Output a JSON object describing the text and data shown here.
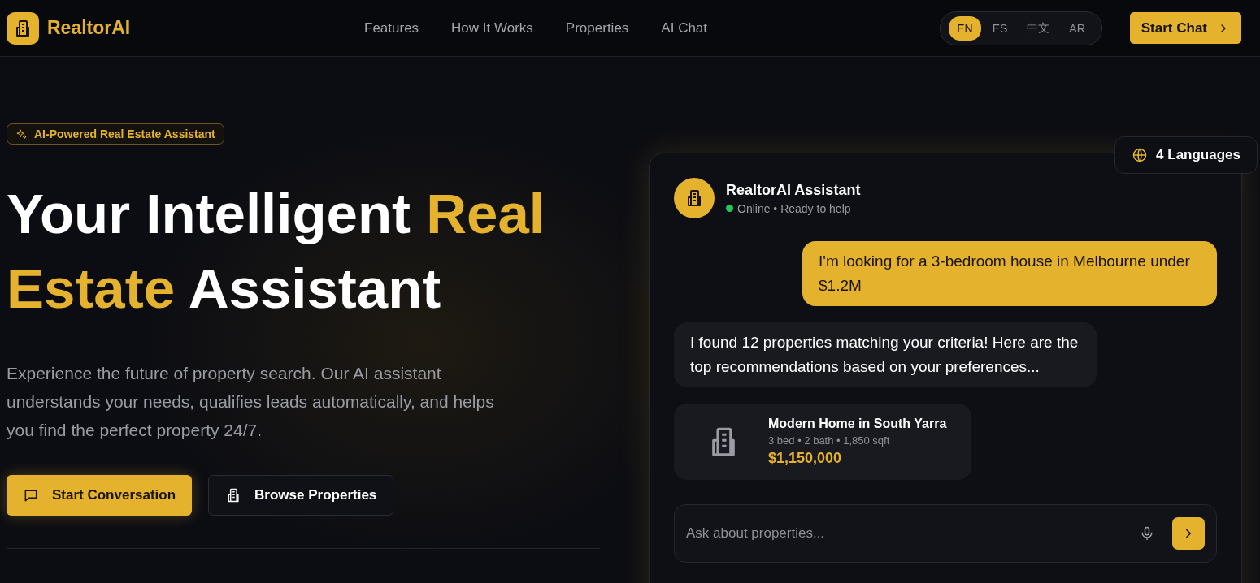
{
  "brand": {
    "name": "RealtorAI"
  },
  "nav": {
    "links": [
      "Features",
      "How It Works",
      "Properties",
      "AI Chat"
    ]
  },
  "languages": [
    {
      "label": "EN",
      "selected": true
    },
    {
      "label": "ES",
      "selected": false
    },
    {
      "label": "中文",
      "selected": false
    },
    {
      "label": "AR",
      "selected": false
    }
  ],
  "header_button": {
    "label": "Start Chat"
  },
  "hero": {
    "badge": "AI-Powered Real Estate Assistant",
    "heading": [
      {
        "text": "Your Intelligent ",
        "highlight": false
      },
      {
        "text": "Real Estate",
        "highlight": true
      },
      {
        "text": " Assistant",
        "highlight": false
      }
    ],
    "description": "Experience the future of property search. Our AI assistant understands your needs, qualifies leads automatically, and helps you find the perfect property 24/7.",
    "buttons": [
      {
        "label": "Start Conversation",
        "kind": "primary"
      },
      {
        "label": "Browse Properties",
        "kind": "secondary"
      }
    ]
  },
  "languages_badge": "4 Languages",
  "chat": {
    "assistant_name": "RealtorAI Assistant",
    "online": true,
    "status": "Online • Ready to help",
    "messages": [
      {
        "kind": "outgoing",
        "text": "I'm looking for a 3-bedroom house in Melbourne under $1.2M"
      },
      {
        "kind": "incoming",
        "text": "I found 12 properties matching your criteria! Here are the top recommendations based on your preferences..."
      }
    ],
    "property": {
      "title": "Modern Home in South Yarra",
      "details": "3 bed • 2 bath • 1,850 sqft",
      "price": "$1,150,000"
    },
    "input": {
      "placeholder": "Ask about properties..."
    }
  }
}
